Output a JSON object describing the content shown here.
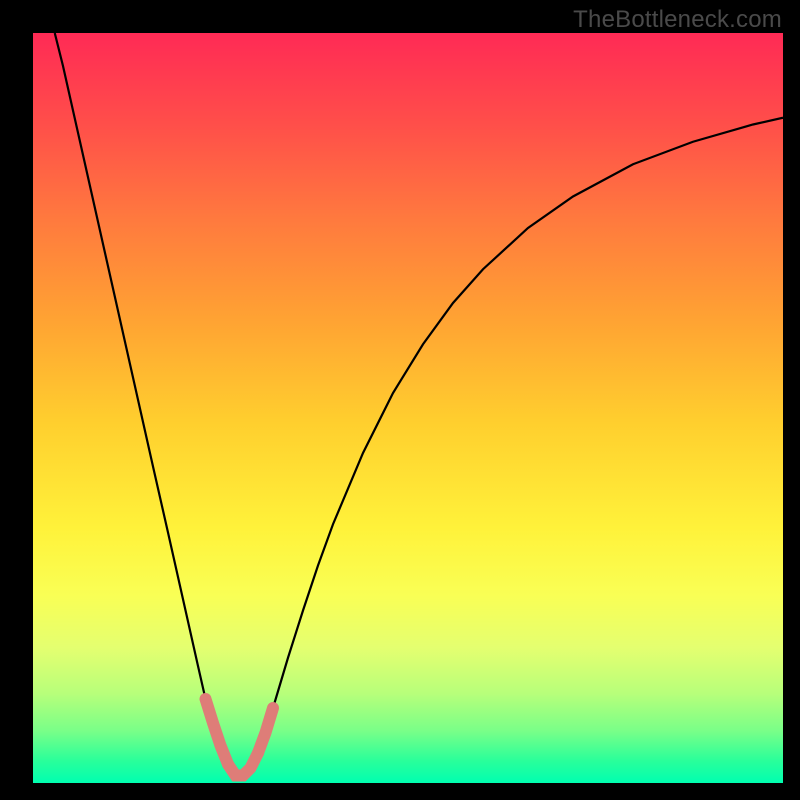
{
  "watermark": "TheBottleneck.com",
  "colors": {
    "background": "#000000",
    "curve": "#000000",
    "highlight": "#de7d78",
    "gradient_top": "#ff2a55",
    "gradient_bottom": "#00ffb0"
  },
  "chart_data": {
    "type": "line",
    "title": "",
    "xlabel": "",
    "ylabel": "",
    "xlim": [
      0,
      100
    ],
    "ylim": [
      0,
      100
    ],
    "grid": false,
    "note": "Axes are unlabeled; x and y are normalized 0–100 reading from pixel positions. The curve depicts a bottleneck-style V shape with minimum near x≈27, y≈0; two short pink highlight segments sit near the bottom of the V.",
    "series": [
      {
        "name": "bottleneck-curve",
        "x": [
          2.9,
          4,
          6,
          8,
          10,
          12,
          14,
          16,
          18,
          20,
          22,
          23,
          24,
          25,
          26,
          27,
          28,
          29,
          30,
          31,
          32,
          34,
          36,
          38,
          40,
          44,
          48,
          52,
          56,
          60,
          66,
          72,
          80,
          88,
          96,
          100
        ],
        "y": [
          100,
          95.6,
          86.7,
          77.8,
          68.9,
          60.0,
          51.1,
          42.2,
          33.4,
          24.5,
          15.6,
          11.2,
          8.0,
          5.0,
          2.5,
          1.0,
          1.0,
          2.0,
          4.0,
          6.7,
          10.0,
          16.7,
          23.0,
          29.0,
          34.5,
          44.0,
          52.0,
          58.5,
          64.0,
          68.5,
          74.0,
          78.2,
          82.5,
          85.5,
          87.8,
          88.7
        ]
      },
      {
        "name": "highlight-left",
        "x": [
          23.0,
          24.0,
          25.0,
          26.0
        ],
        "y": [
          11.2,
          8.0,
          5.0,
          2.5
        ]
      },
      {
        "name": "highlight-bottom",
        "x": [
          26.0,
          27.0,
          28.0,
          29.0,
          30.0
        ],
        "y": [
          2.5,
          1.0,
          1.0,
          2.0,
          4.0
        ]
      },
      {
        "name": "highlight-right",
        "x": [
          30.0,
          31.0,
          32.0
        ],
        "y": [
          4.0,
          6.7,
          10.0
        ]
      }
    ]
  }
}
